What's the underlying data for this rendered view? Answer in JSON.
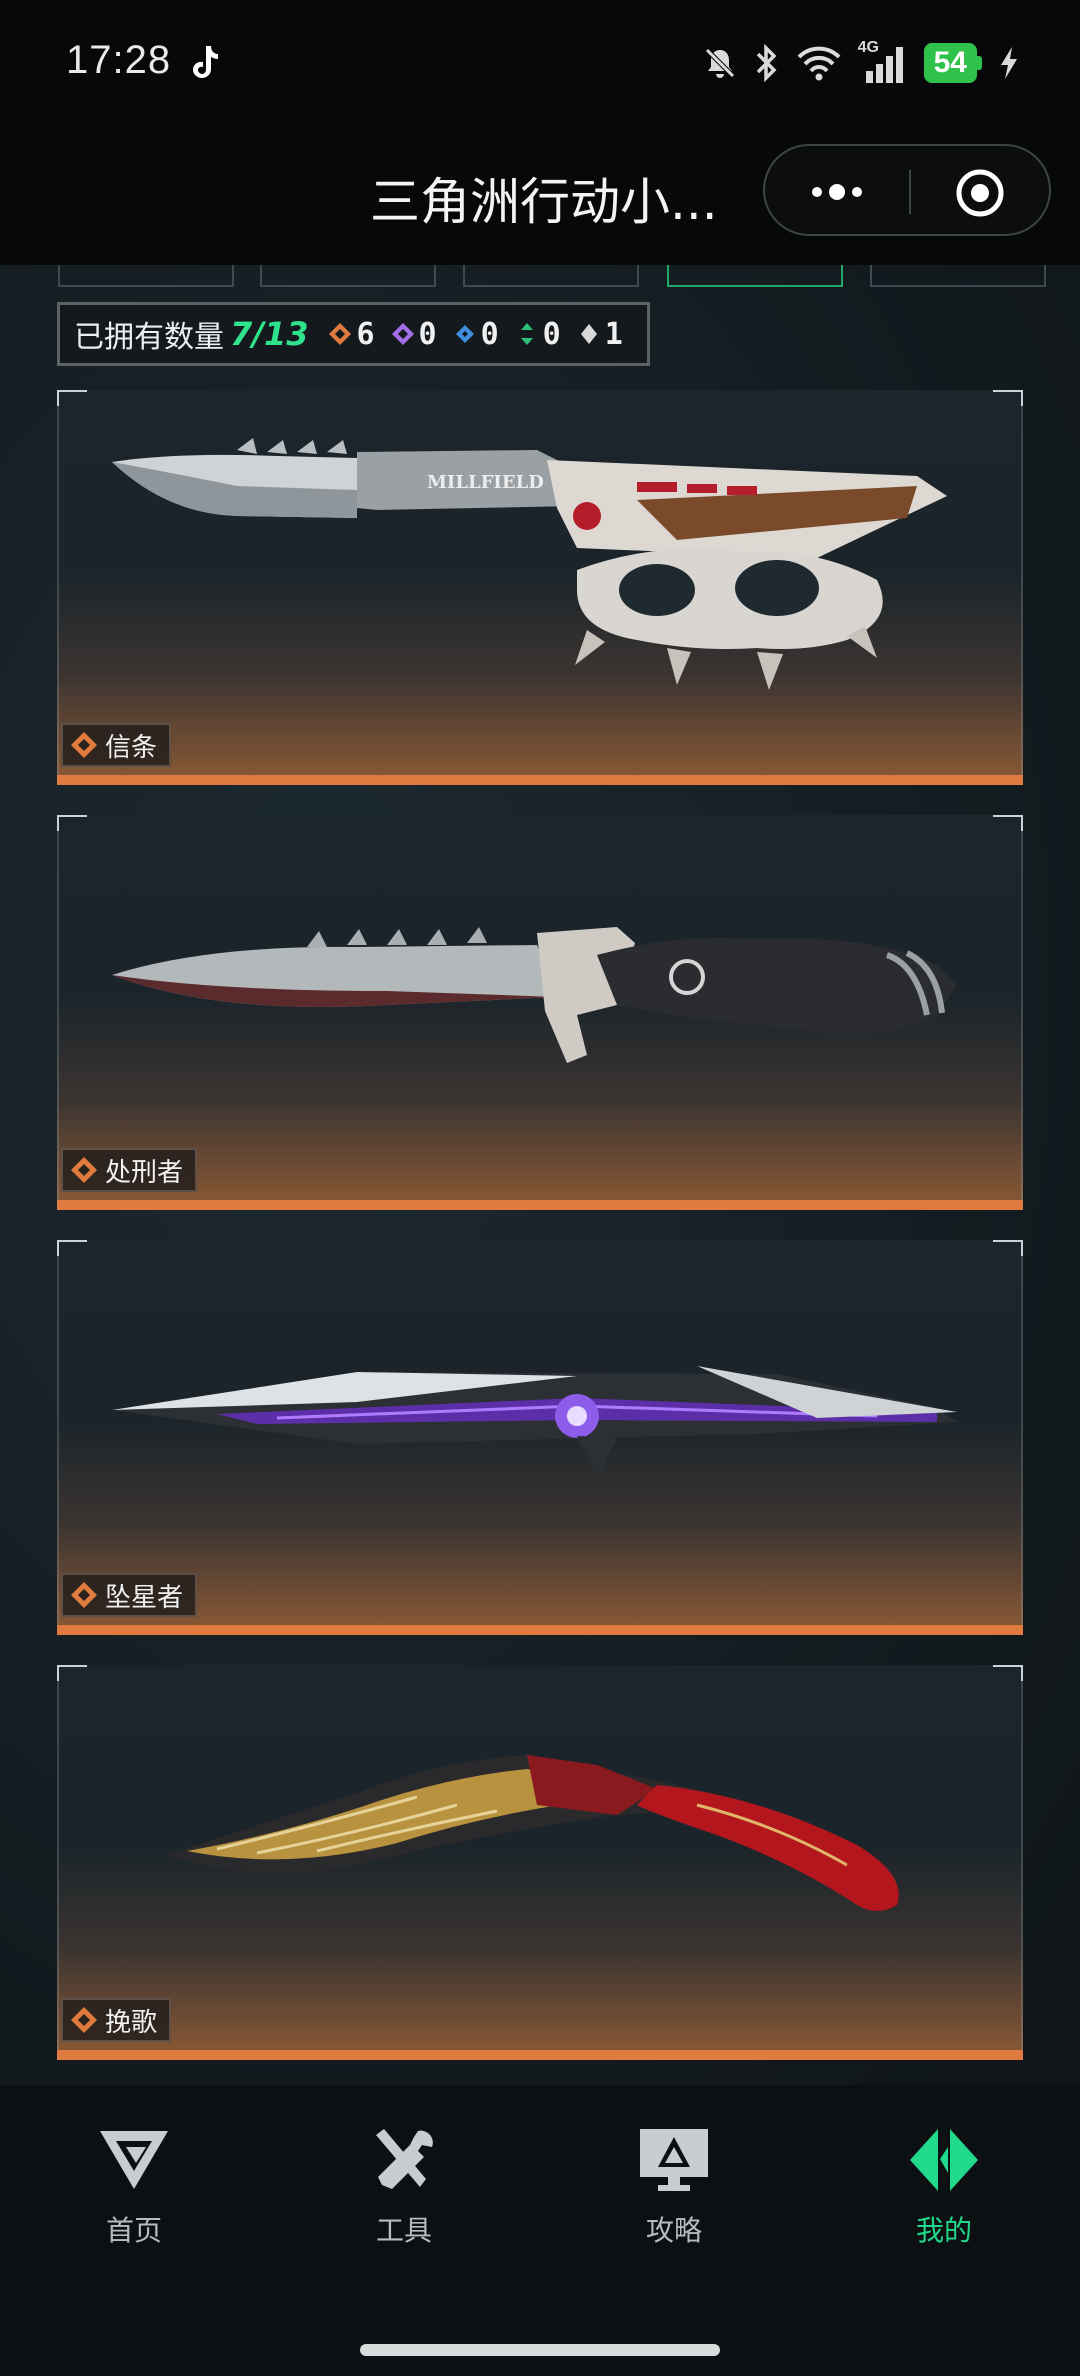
{
  "status_bar": {
    "time": "17:28",
    "network": "4G",
    "battery": "54"
  },
  "nav": {
    "title": "三角洲行动小..."
  },
  "owned": {
    "label": "已拥有数量",
    "count": "7/13",
    "orange": "6",
    "purple": "0",
    "blue": "0",
    "green": "0",
    "white": "1"
  },
  "colors": {
    "accent": "#2ee38c",
    "orange": "#e07b3f",
    "purple": "#a46ee8",
    "blue": "#3f8ee0",
    "green": "#2fbf7a",
    "white": "#d8d8d8"
  },
  "items": [
    {
      "name": "信条",
      "icon": "orange-rarity-icon"
    },
    {
      "name": "处刑者",
      "icon": "orange-rarity-icon"
    },
    {
      "name": "坠星者",
      "icon": "orange-rarity-icon"
    },
    {
      "name": "挽歌",
      "icon": "orange-rarity-icon"
    }
  ],
  "tabbar": [
    {
      "label": "首页",
      "icon": "delta-logo-icon"
    },
    {
      "label": "工具",
      "icon": "tools-icon"
    },
    {
      "label": "攻略",
      "icon": "guide-monitor-icon"
    },
    {
      "label": "我的",
      "icon": "profile-diamond-icon",
      "active": true
    }
  ]
}
